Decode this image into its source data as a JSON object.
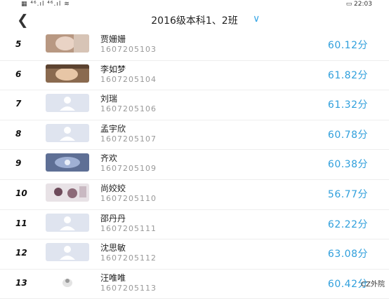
{
  "status_bar": {
    "left": "▦ ⁴⁶.ıl ⁴⁶.ıl ≋",
    "right": "▭ 22:03"
  },
  "header": {
    "back_icon": "chevron-left-icon",
    "title": "2016级本科1、2班",
    "dropdown_icon": "chevron-down-icon"
  },
  "students": [
    {
      "rank": "5",
      "name": "贾姗姗",
      "id": "1607205103",
      "score": "60.12分",
      "avatar": "photo"
    },
    {
      "rank": "6",
      "name": "李如梦",
      "id": "1607205104",
      "score": "61.82分",
      "avatar": "photo"
    },
    {
      "rank": "7",
      "name": "刘瑞",
      "id": "1607205106",
      "score": "61.32分",
      "avatar": "default"
    },
    {
      "rank": "8",
      "name": "孟宇欣",
      "id": "1607205107",
      "score": "60.78分",
      "avatar": "default"
    },
    {
      "rank": "9",
      "name": "齐欢",
      "id": "1607205109",
      "score": "60.38分",
      "avatar": "photo"
    },
    {
      "rank": "10",
      "name": "尚姣姣",
      "id": "1607205110",
      "score": "56.77分",
      "avatar": "photo"
    },
    {
      "rank": "11",
      "name": "邵丹丹",
      "id": "1607205111",
      "score": "62.22分",
      "avatar": "default"
    },
    {
      "rank": "12",
      "name": "沈思敏",
      "id": "1607205112",
      "score": "63.08分",
      "avatar": "default"
    },
    {
      "rank": "13",
      "name": "汪唯唯",
      "id": "1607205113",
      "score": "60.42分",
      "avatar": "photo"
    }
  ],
  "watermark": "CZ外院"
}
